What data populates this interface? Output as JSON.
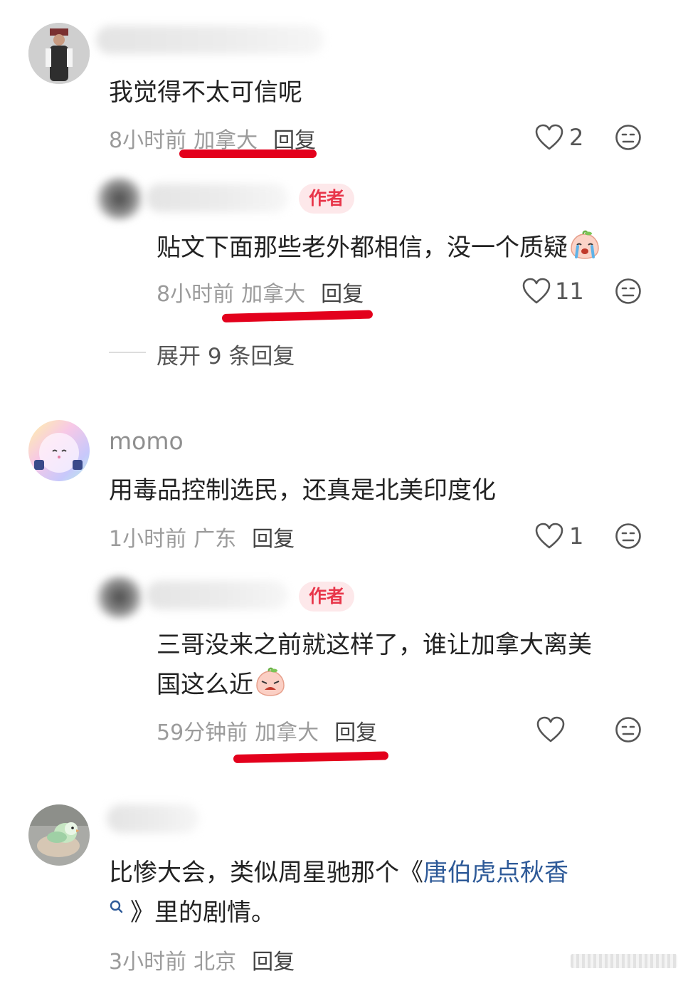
{
  "comments": [
    {
      "text": "我觉得不太可信呢",
      "time": "8小时前",
      "location": "加拿大",
      "reply_label": "回复",
      "likes": "2"
    },
    {
      "author_tag": "作者",
      "text": "贴文下面那些老外都相信，没一个质疑",
      "time": "8小时前",
      "location": "加拿大",
      "reply_label": "回复",
      "likes": "11"
    },
    {
      "username": "momo",
      "text": "用毒品控制选民，还真是北美印度化",
      "time": "1小时前",
      "location": "广东",
      "reply_label": "回复",
      "likes": "1"
    },
    {
      "author_tag": "作者",
      "text_line1": "三哥没来之前就这样了，谁让加拿大离美",
      "text_line2": "国这么近",
      "time": "59分钟前",
      "location": "加拿大",
      "reply_label": "回复",
      "likes": ""
    },
    {
      "text_line1_prefix": "比惨大会，类似周星驰那个《",
      "link_text": "唐伯虎点秋香",
      "text_line2_suffix": "》里的剧情。",
      "time": "3小时前",
      "location": "北京",
      "reply_label": "回复"
    }
  ],
  "expand_replies": "展开 9 条回复",
  "icons": {
    "like": "heart-outline-icon",
    "more": "neutral-face-icon",
    "search": "search-icon",
    "emoji": "crying-peach-emoji"
  },
  "colors": {
    "underline": "#e3001c",
    "author_tag_bg": "#fde8ea",
    "author_tag_text": "#e8364a",
    "link": "#2e5a98"
  }
}
